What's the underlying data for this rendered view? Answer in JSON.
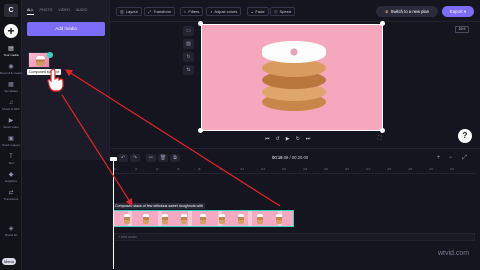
{
  "app": {
    "logo_text": "C"
  },
  "rail": {
    "items": [
      {
        "label": "Your media",
        "icon": "folder-icon"
      },
      {
        "label": "Record & create",
        "icon": "record-icon"
      },
      {
        "label": "Templates",
        "icon": "templates-icon"
      },
      {
        "label": "Music & SFX",
        "icon": "music-icon"
      },
      {
        "label": "Stock video",
        "icon": "stock-video-icon"
      },
      {
        "label": "Stock images",
        "icon": "stock-images-icon"
      },
      {
        "label": "Text",
        "icon": "text-icon"
      },
      {
        "label": "Graphics",
        "icon": "graphics-icon"
      },
      {
        "label": "Transitions",
        "icon": "transitions-icon"
      },
      {
        "label": "Brand kit",
        "icon": "brand-kit-icon"
      }
    ],
    "menu_label": "Menu"
  },
  "library": {
    "tabs": [
      "ALL",
      "PHOTO",
      "VIDEO",
      "AUDIO"
    ],
    "add_media_label": "Add media",
    "thumb_tooltip": "Composed stack of"
  },
  "toolbar": {
    "buttons": [
      "Layout",
      "Transform",
      "Filters",
      "Adjust colors",
      "Fade",
      "Speed"
    ],
    "upgrade_label": "Switch to a new plan",
    "export_label": "Export"
  },
  "preview": {
    "ratio": "16:9"
  },
  "timeline": {
    "timecode_current": "00:19",
    "timecode_frac": ".08",
    "timecode_total": "/ 00:20",
    "timecode_total_frac": ".00",
    "ruler_ticks": [
      "|0",
      "|2",
      "|4",
      "|6",
      "|8",
      "|10",
      "|12",
      "|14",
      "|16",
      "|18",
      "|20",
      "|22",
      "|24",
      "|26",
      "|28",
      "|30",
      "|32"
    ],
    "clip_label": "Composed stack of few delicious sweet doughnuts with",
    "audio_track_label": "+ Add audio"
  },
  "watermark": "wtvid.com",
  "colors": {
    "accent": "#7c6cf7",
    "selection": "#2fd8c0",
    "annotation": "#e6212b"
  }
}
